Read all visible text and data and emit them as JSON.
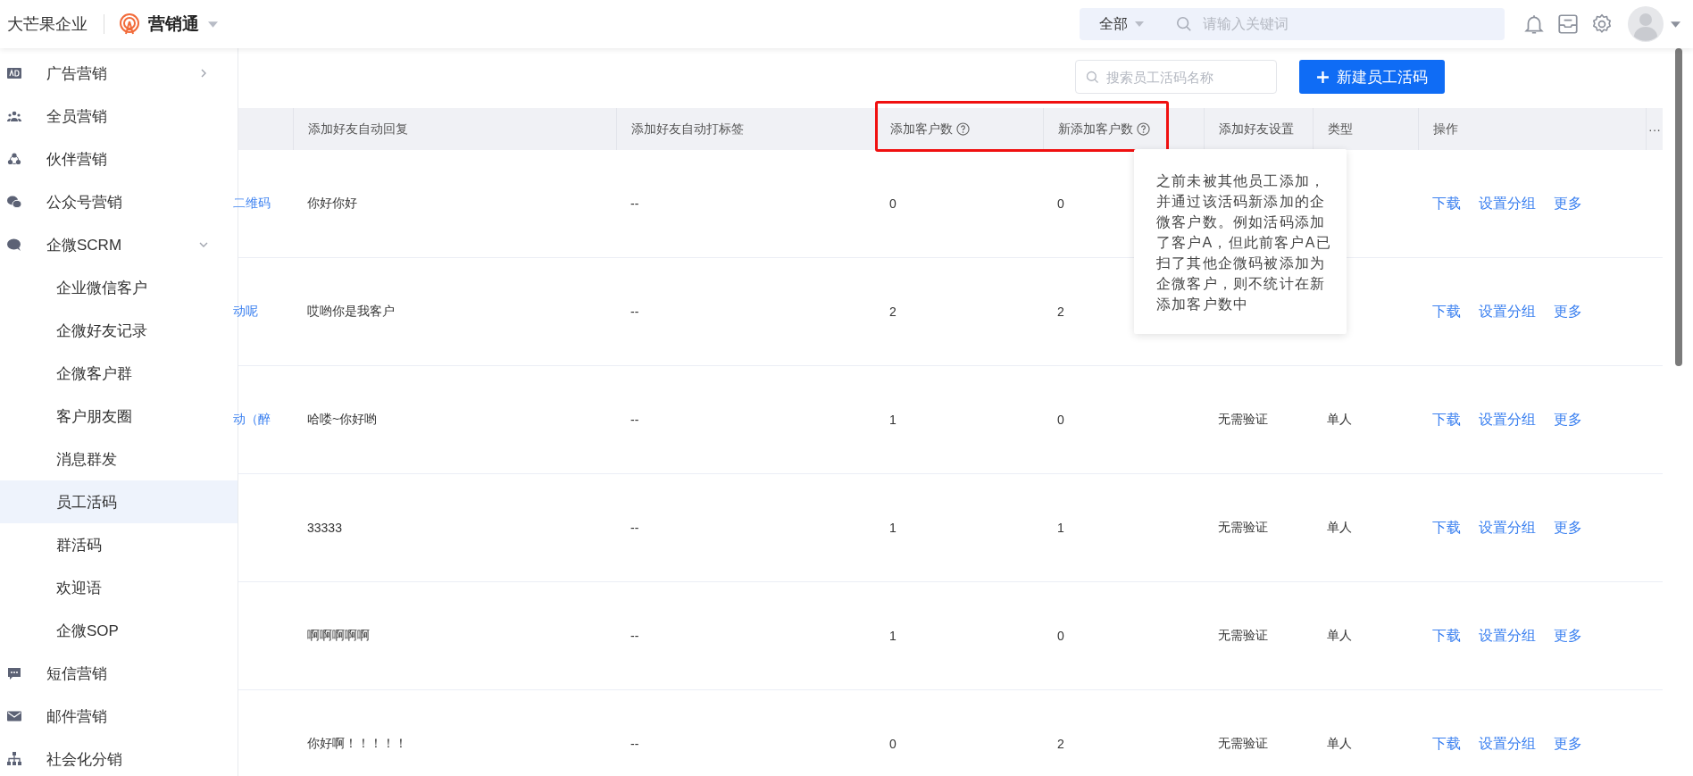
{
  "header": {
    "company": "大芒果企业",
    "app_name": "营销通",
    "scope": "全部",
    "search_placeholder": "请输入关键词"
  },
  "sidebar": {
    "items": [
      {
        "label": "广告营销",
        "kind": "ad",
        "expanded": false,
        "selected": false
      },
      {
        "label": "全员营销",
        "kind": "people",
        "selected": false
      },
      {
        "label": "伙伴营销",
        "kind": "partner",
        "selected": false
      },
      {
        "label": "公众号营销",
        "kind": "wechat",
        "selected": false
      },
      {
        "label": "企微SCRM",
        "kind": "chat",
        "expanded": true,
        "selected": false,
        "children": [
          {
            "label": "企业微信客户",
            "selected": false
          },
          {
            "label": "企微好友记录",
            "selected": false
          },
          {
            "label": "企微客户群",
            "selected": false
          },
          {
            "label": "客户朋友圈",
            "selected": false
          },
          {
            "label": "消息群发",
            "selected": false
          },
          {
            "label": "员工活码",
            "selected": true
          },
          {
            "label": "群活码",
            "selected": false
          },
          {
            "label": "欢迎语",
            "selected": false
          },
          {
            "label": "企微SOP",
            "selected": false
          }
        ]
      },
      {
        "label": "短信营销",
        "kind": "sms",
        "selected": false
      },
      {
        "label": "邮件营销",
        "kind": "mail",
        "selected": false
      },
      {
        "label": "社会化分销",
        "kind": "org",
        "selected": false
      }
    ]
  },
  "toolbar": {
    "search_placeholder": "搜索员工活码名称",
    "create_button": "新建员工活码"
  },
  "table": {
    "columns": [
      {
        "label": "添加好友自动回复",
        "help": false
      },
      {
        "label": "添加好友自动打标签",
        "help": false
      },
      {
        "label": "添加客户数",
        "help": true
      },
      {
        "label": "新添加客户数",
        "help": true
      },
      {
        "label": "添加好友设置",
        "help": false
      },
      {
        "label": "类型",
        "help": false
      },
      {
        "label": "操作",
        "help": false
      },
      {
        "label": "···"
      }
    ],
    "rows": [
      {
        "name": "二维码",
        "auto_reply": "你好你好",
        "auto_tag": "--",
        "added": "0",
        "new_added": "0",
        "actions": [
          "下载",
          "设置分组",
          "更多"
        ]
      },
      {
        "name": "动呢",
        "auto_reply": "哎哟你是我客户",
        "auto_tag": "--",
        "added": "2",
        "new_added": "2",
        "actions": [
          "下载",
          "设置分组",
          "更多"
        ]
      },
      {
        "name": "动（醉",
        "auto_reply": "哈喽~你好哟",
        "auto_tag": "--",
        "added": "1",
        "new_added": "0",
        "setting": "无需验证",
        "type": "单人",
        "actions": [
          "下载",
          "设置分组",
          "更多"
        ]
      },
      {
        "auto_reply": "33333",
        "auto_tag": "--",
        "added": "1",
        "new_added": "1",
        "setting": "无需验证",
        "type": "单人",
        "actions": [
          "下载",
          "设置分组",
          "更多"
        ]
      },
      {
        "auto_reply": "啊啊啊啊啊",
        "auto_tag": "--",
        "added": "1",
        "new_added": "0",
        "setting": "无需验证",
        "type": "单人",
        "actions": [
          "下载",
          "设置分组",
          "更多"
        ]
      },
      {
        "auto_reply": "你好啊！！！！！",
        "auto_tag": "--",
        "added": "0",
        "new_added": "2",
        "setting": "无需验证",
        "type": "单人",
        "actions": [
          "下载",
          "设置分组",
          "更多"
        ]
      }
    ]
  },
  "tooltip": {
    "text": "之前未被其他员工添加，并通过该活码新添加的企微客户数。例如活码添加了客户A，但此前客户A已扫了其他企微码被添加为企微客户，则不统计在新添加客户数中"
  }
}
